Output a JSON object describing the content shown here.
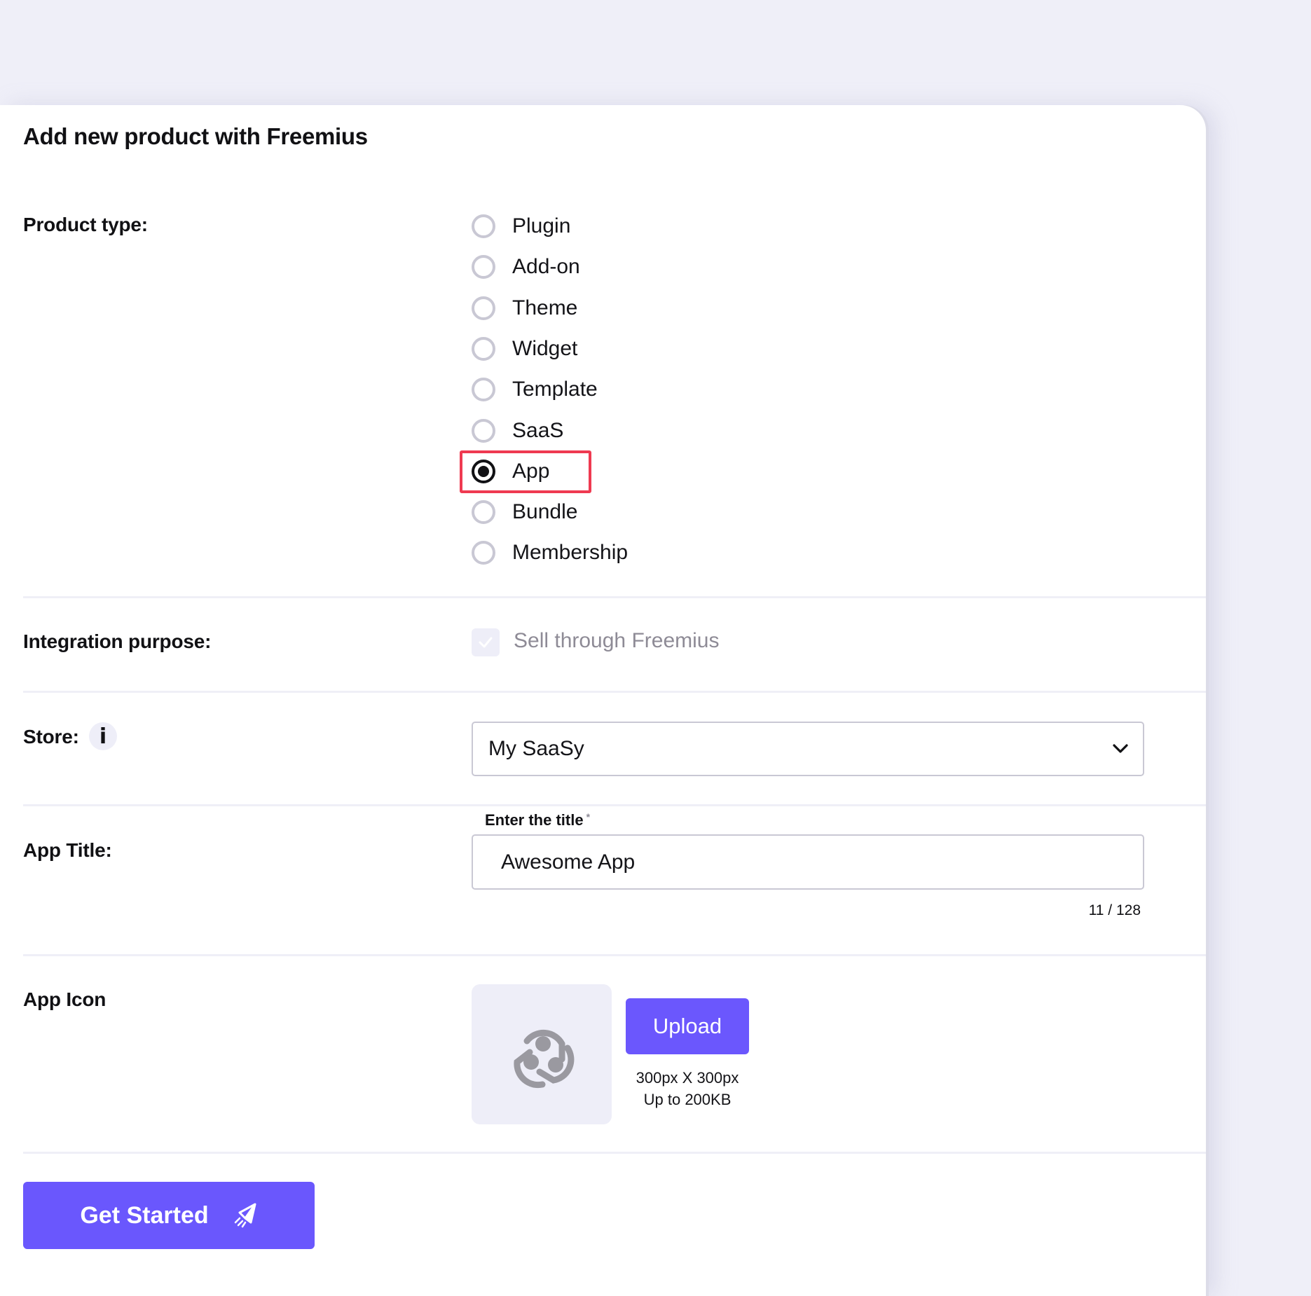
{
  "page": {
    "title": "Add new product with Freemius"
  },
  "product_type": {
    "label": "Product type:",
    "options": [
      {
        "label": "Plugin",
        "checked": false
      },
      {
        "label": "Add-on",
        "checked": false
      },
      {
        "label": "Theme",
        "checked": false
      },
      {
        "label": "Widget",
        "checked": false
      },
      {
        "label": "Template",
        "checked": false
      },
      {
        "label": "SaaS",
        "checked": false
      },
      {
        "label": "App",
        "checked": true
      },
      {
        "label": "Bundle",
        "checked": false
      },
      {
        "label": "Membership",
        "checked": false
      }
    ],
    "highlighted_option": "App"
  },
  "integration": {
    "label": "Integration purpose:",
    "checkbox_label": "Sell through Freemius",
    "checked": true,
    "disabled": true
  },
  "store": {
    "label": "Store:",
    "info_icon": "i",
    "selected": "My SaaSy"
  },
  "app_title": {
    "label": "App Title:",
    "field_label": "Enter the title",
    "required_mark": "*",
    "value": "Awesome App",
    "counter": "11 / 128"
  },
  "app_icon": {
    "label": "App Icon",
    "upload_label": "Upload",
    "hint_size": "300px X 300px",
    "hint_limit": "Up to 200KB"
  },
  "cta": {
    "label": "Get Started"
  },
  "colors": {
    "accent": "#6b57fd",
    "highlight": "#ef3a51",
    "background": "#efeff8"
  }
}
